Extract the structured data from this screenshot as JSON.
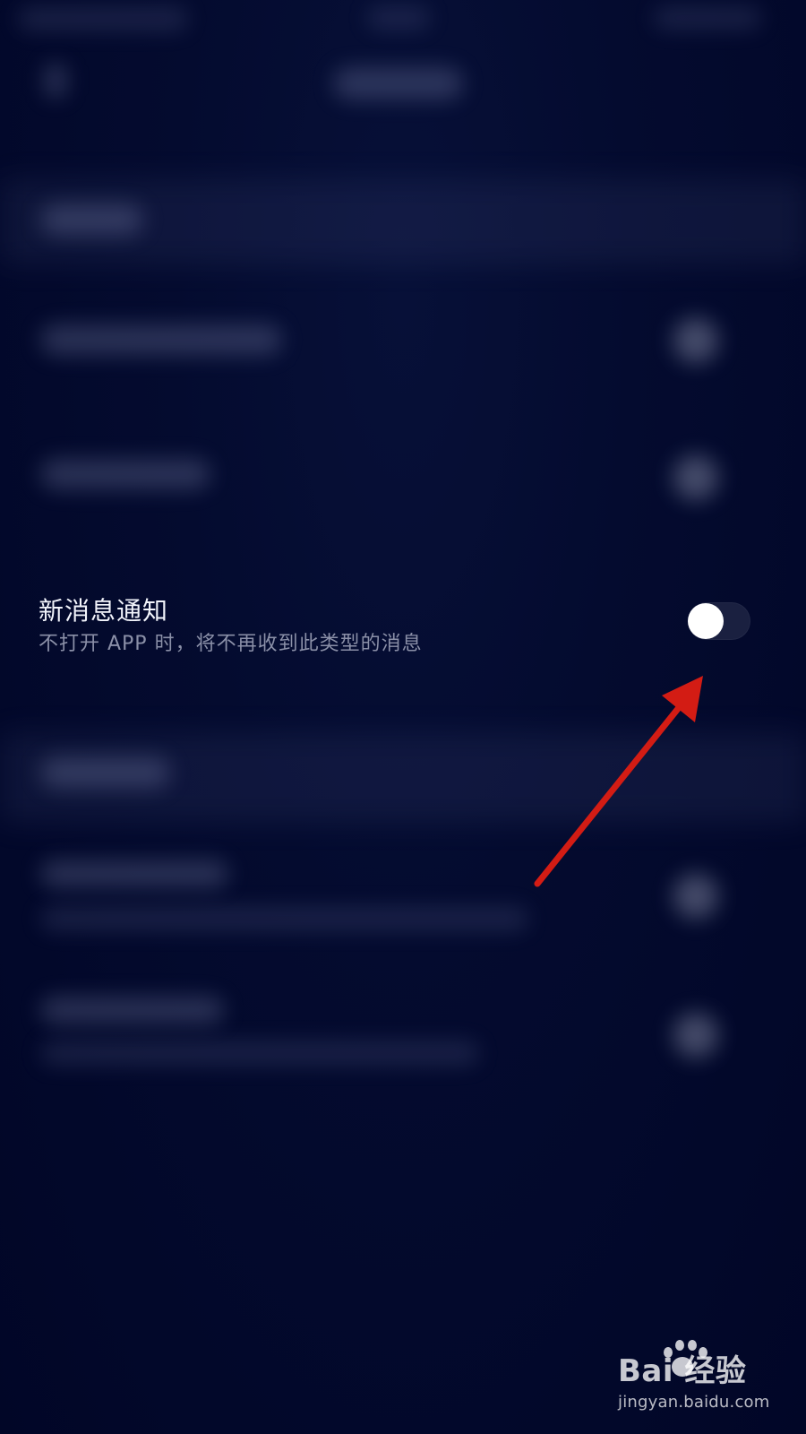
{
  "settings": {
    "notification_row": {
      "title": "新消息通知",
      "description": "不打开 APP 时，将不再收到此类型的消息"
    },
    "toggle": {
      "state": "off"
    }
  },
  "annotation": {
    "arrow_color": "#d31c14",
    "icon": "red-arrow-icon"
  },
  "watermark": {
    "main": "Bai  经验",
    "sub": "jingyan.baidu.com",
    "icon": "paw-icon"
  },
  "colors": {
    "background": "#02072a",
    "title_text": "#f2f4fb",
    "description_text": "#8b90a8",
    "toggle_track": "#1a2040",
    "toggle_knob": "#ffffff"
  }
}
